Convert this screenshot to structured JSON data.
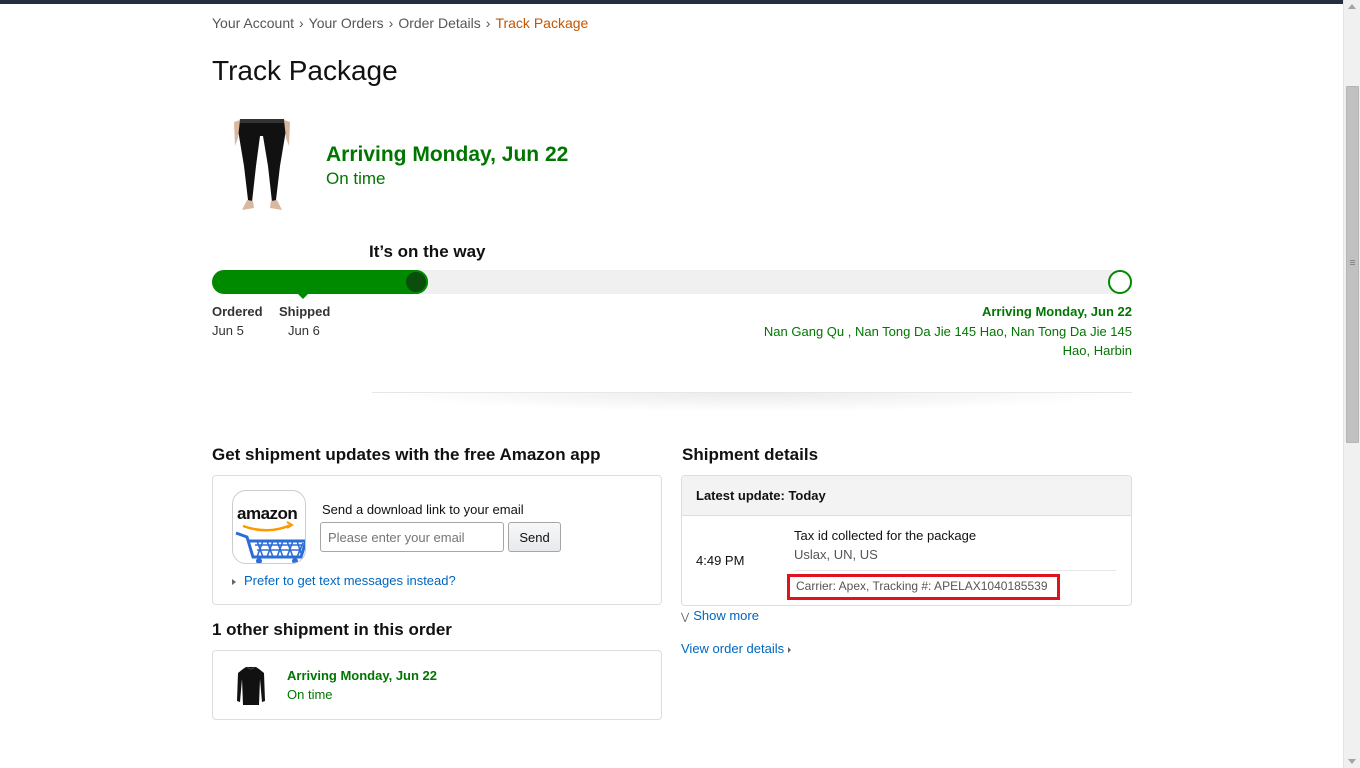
{
  "breadcrumb": {
    "items": [
      "Your Account",
      "Your Orders",
      "Order Details",
      "Track Package"
    ],
    "separator": "›"
  },
  "page_title": "Track Package",
  "shipment": {
    "arrival": "Arriving Monday, Jun 22",
    "status": "On time",
    "progress_heading": "It’s on the way",
    "progress_fraction": 0.235,
    "milestones": [
      {
        "label": "Ordered",
        "date": "Jun 5"
      },
      {
        "label": "Shipped",
        "date": "Jun 6"
      }
    ],
    "destination": {
      "arrival": "Arriving Monday, Jun 22",
      "address": "Nan Gang Qu , Nan Tong Da Jie 145 Hao, Nan Tong Da Jie 145 Hao, Harbin"
    }
  },
  "app_section": {
    "title": "Get shipment updates with the free Amazon app",
    "app_name": "amazon",
    "email_label": "Send a download link to your email",
    "email_placeholder": "Please enter your email",
    "send_label": "Send",
    "text_link": "Prefer to get text messages instead?"
  },
  "shipment_details": {
    "title": "Shipment details",
    "latest_update": "Latest update: Today",
    "event": {
      "time": "4:49 PM",
      "description": "Tax id collected for the package",
      "location": "Uslax, UN, US",
      "carrier": "Carrier: Apex, Tracking #: APELAX1040185539"
    },
    "show_more": "Show more",
    "view_order": "View order details"
  },
  "other_shipments": {
    "title": "1 other shipment in this order",
    "items": [
      {
        "arrival": "Arriving Monday, Jun 22",
        "status": "On time"
      }
    ]
  },
  "colors": {
    "success_green": "#007600",
    "link_blue": "#0066c0",
    "breadcrumb_current": "#c45500",
    "highlight_red": "#e0121f"
  }
}
